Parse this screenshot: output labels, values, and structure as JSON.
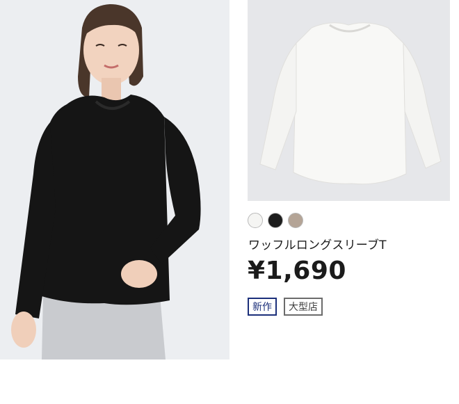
{
  "product": {
    "name": "ワッフルロングスリーブT",
    "price": "¥1,690",
    "tags": {
      "new": "新作",
      "store": "大型店"
    },
    "colors": [
      "#f5f5f3",
      "#1d1d1d",
      "#b4a496"
    ]
  }
}
